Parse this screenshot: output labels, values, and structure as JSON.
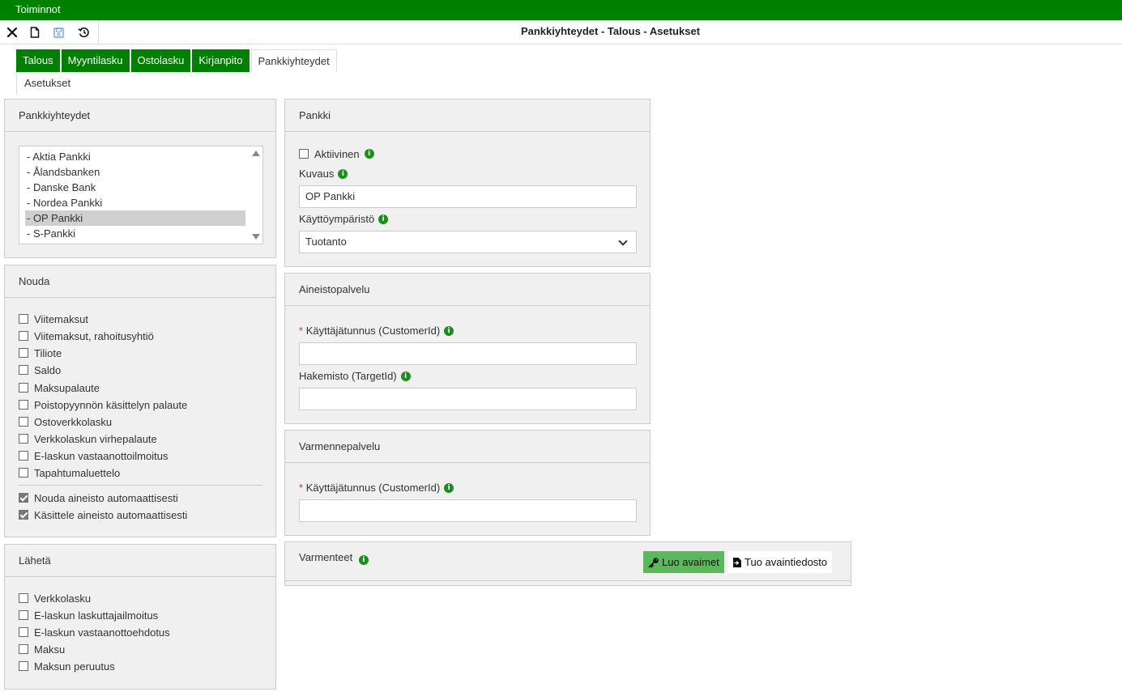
{
  "topbar": {
    "menu_label": "Toiminnot"
  },
  "toolbar": {
    "title": "Pankkiyhteydet - Talous - Asetukset",
    "icons": [
      "close-icon",
      "new-document-icon",
      "save-icon",
      "history-icon"
    ]
  },
  "tabs": [
    {
      "label": "Talous",
      "active": false
    },
    {
      "label": "Myyntilasku",
      "active": false
    },
    {
      "label": "Ostolasku",
      "active": false
    },
    {
      "label": "Kirjanpito",
      "active": false
    },
    {
      "label": "Pankkiyhteydet",
      "active": true
    }
  ],
  "subtab": {
    "label": "Asetukset"
  },
  "connections": {
    "title": "Pankkiyhteydet",
    "items": [
      "- Aktia Pankki",
      "- Ålandsbanken",
      "- Danske Bank",
      "- Nordea Pankki",
      "- OP Pankki",
      "- S-Pankki"
    ],
    "selected": "- OP Pankki"
  },
  "fetch": {
    "title": "Nouda",
    "options": [
      {
        "label": "Viitemaksut",
        "checked": false
      },
      {
        "label": "Viitemaksut, rahoitusyhtiö",
        "checked": false
      },
      {
        "label": "Tiliote",
        "checked": false
      },
      {
        "label": "Saldo",
        "checked": false
      },
      {
        "label": "Maksupalaute",
        "checked": false
      },
      {
        "label": "Poistopyynnön käsittelyn palaute",
        "checked": false
      },
      {
        "label": "Ostoverkkolasku",
        "checked": false
      },
      {
        "label": "Verkkolaskun virhepalaute",
        "checked": false
      },
      {
        "label": "E-laskun vastaanottoilmoitus",
        "checked": false
      },
      {
        "label": "Tapahtumaluettelo",
        "checked": false
      }
    ],
    "auto_options": [
      {
        "label": "Nouda aineisto automaattisesti",
        "checked": true
      },
      {
        "label": "Käsittele aineisto automaattisesti",
        "checked": true
      }
    ]
  },
  "send": {
    "title": "Lähetä",
    "options": [
      {
        "label": "Verkkolasku",
        "checked": false
      },
      {
        "label": "E-laskun laskuttajailmoitus",
        "checked": false
      },
      {
        "label": "E-laskun vastaanottoehdotus",
        "checked": false
      },
      {
        "label": "Maksu",
        "checked": false
      },
      {
        "label": "Maksun peruutus",
        "checked": false
      }
    ]
  },
  "bank": {
    "title": "Pankki",
    "active_label": "Aktiivinen",
    "active_checked": false,
    "description_label": "Kuvaus",
    "description_value": "OP Pankki",
    "environment_label": "Käyttöympäristö",
    "environment_value": "Tuotanto"
  },
  "material_service": {
    "title": "Aineistopalvelu",
    "customer_id_label": "Käyttäjätunnus (CustomerId)",
    "customer_id_value": "",
    "target_id_label": "Hakemisto (TargetId)",
    "target_id_value": ""
  },
  "certificate_service": {
    "title": "Varmennepalvelu",
    "customer_id_label": "Käyttäjätunnus (CustomerId)",
    "customer_id_value": ""
  },
  "certificates": {
    "title": "Varmenteet",
    "create_keys_label": "Luo avaimet",
    "import_keyfile_label": "Tuo avaintiedosto"
  },
  "colors": {
    "brand_green": "#008000",
    "button_green": "#5cb85c",
    "info_green": "#1a8f1a",
    "required": "#c0392b"
  }
}
